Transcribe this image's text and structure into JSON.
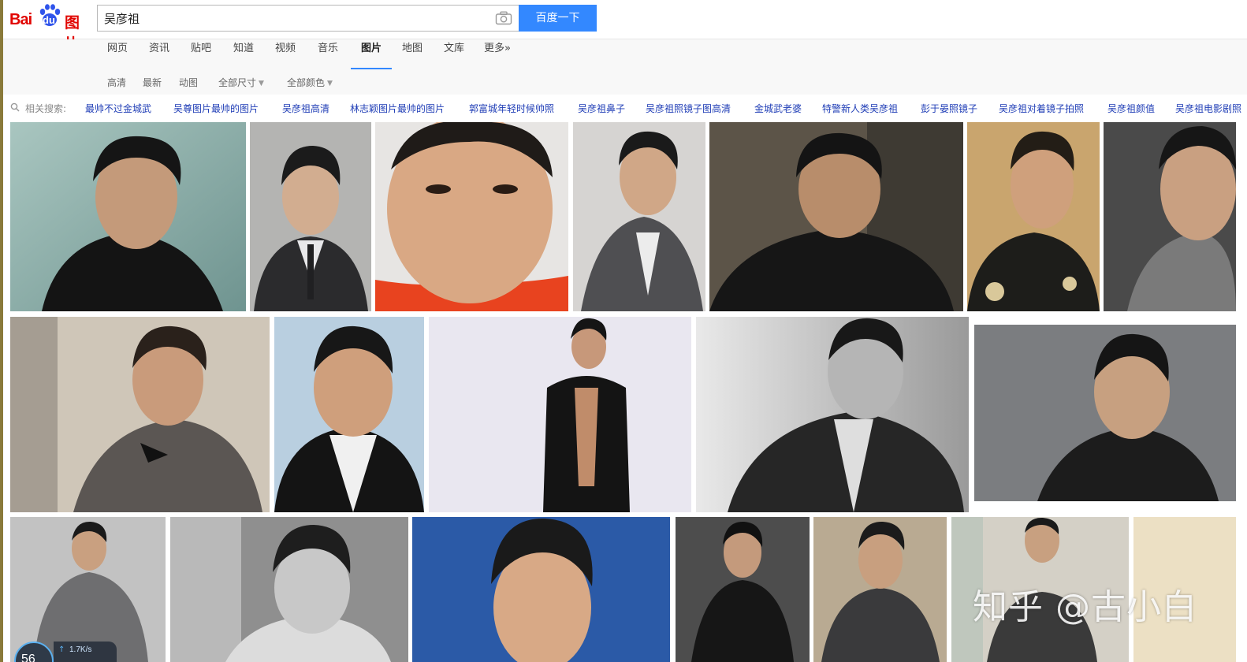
{
  "logo": {
    "bai": "Bai",
    "du": "du",
    "tupian": "图片"
  },
  "search": {
    "value": "吴彦祖",
    "button_label": "百度一下"
  },
  "nav": {
    "tabs": [
      {
        "label": "网页"
      },
      {
        "label": "资讯"
      },
      {
        "label": "贴吧"
      },
      {
        "label": "知道"
      },
      {
        "label": "视频"
      },
      {
        "label": "音乐"
      },
      {
        "label": "图片",
        "active": true
      },
      {
        "label": "地图"
      },
      {
        "label": "文库"
      },
      {
        "label": "更多»"
      }
    ]
  },
  "filters": [
    {
      "label": "高清"
    },
    {
      "label": "最新"
    },
    {
      "label": "动图"
    },
    {
      "label": "全部尺寸",
      "dropdown": true
    },
    {
      "label": "全部颜色",
      "dropdown": true
    }
  ],
  "related": {
    "label": "相关搜索:",
    "links": [
      "最帅不过金城武",
      "吴尊图片最帅的图片",
      "吴彦祖高清",
      "林志颖图片最帅的图片",
      "郭富城年轻时候帅照",
      "吴彦祖鼻子",
      "吴彦祖照镜子图高清",
      "金城武老婆",
      "特警新人类吴彦祖",
      "彭于晏照镜子",
      "吴彦祖对着镜子拍照",
      "吴彦祖颜值",
      "吴彦祖电影剧照"
    ]
  },
  "overlay": {
    "speed_value": "56",
    "speed_rate": "1.7K/s",
    "watermark": "知乎 @古小白"
  },
  "colors": {
    "brand_red": "#e10602",
    "brand_blue": "#3388ff",
    "related_link": "#1f3db6"
  },
  "icons": [
    "camera-icon",
    "search-icon",
    "baidu-paw-icon",
    "upload-arrow-icon"
  ]
}
